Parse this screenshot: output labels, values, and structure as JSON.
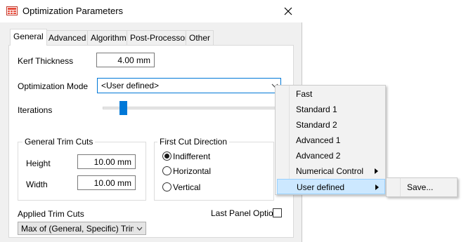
{
  "window": {
    "title": "Optimization Parameters"
  },
  "tabs": [
    {
      "label": "General",
      "active": true
    },
    {
      "label": "Advanced"
    },
    {
      "label": "Algorithm"
    },
    {
      "label": "Post-Processor"
    },
    {
      "label": "Other"
    }
  ],
  "general": {
    "kerf_label": "Kerf Thickness",
    "kerf_value": "4.00 mm",
    "mode_label": "Optimization Mode",
    "mode_value": "<User defined>",
    "iterations_label": "Iterations",
    "iterations_level": 0.12,
    "trim_group": {
      "title": "General Trim Cuts",
      "height_label": "Height",
      "height_value": "10.00 mm",
      "width_label": "Width",
      "width_value": "10.00 mm"
    },
    "first_cut_group": {
      "title": "First Cut Direction",
      "options": [
        "Indifferent",
        "Horizontal",
        "Vertical"
      ],
      "selected": "Indifferent"
    },
    "applied_trim_label": "Applied Trim Cuts",
    "applied_trim_value": "Max of (General, Specific) Trim Cuts",
    "last_panel_label": "Last Panel Option",
    "last_panel_checked": false
  },
  "mode_menu": {
    "items": [
      {
        "label": "Fast"
      },
      {
        "label": "Standard 1"
      },
      {
        "label": "Standard 2"
      },
      {
        "label": "Advanced 1"
      },
      {
        "label": "Advanced 2"
      },
      {
        "label": "Numerical Control",
        "submenu": true
      },
      {
        "label": "User defined",
        "submenu": true,
        "highlighted": true
      }
    ],
    "submenu_items": [
      {
        "label": "Save..."
      }
    ]
  },
  "colors": {
    "accent": "#0078d7",
    "menu_highlight": "#cce8ff",
    "dialog_bg": "#f0f0f0"
  }
}
